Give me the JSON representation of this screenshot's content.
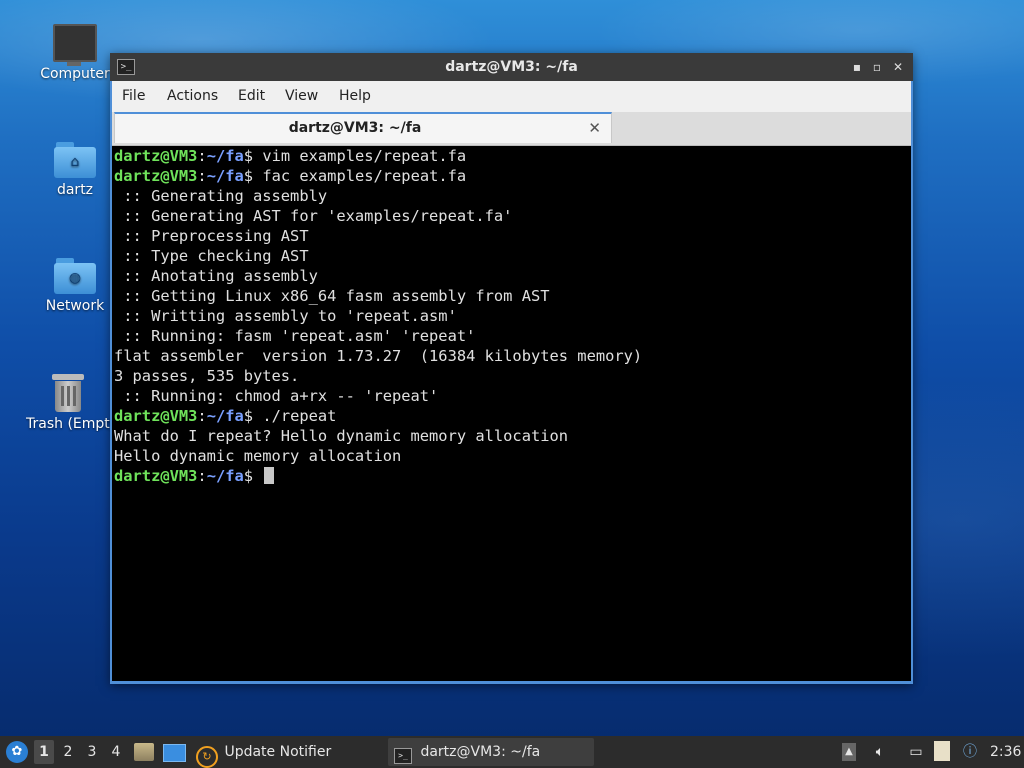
{
  "desktop": {
    "icons": [
      {
        "label": "Computer",
        "icon": "monitor-icon"
      },
      {
        "label": "dartz",
        "icon": "home-folder-icon"
      },
      {
        "label": "Network",
        "icon": "network-folder-icon"
      },
      {
        "label": "Trash (Empty)",
        "icon": "trash-icon"
      }
    ]
  },
  "window": {
    "title": "dartz@VM3: ~/fa",
    "controls": {
      "minimize": "▪",
      "restore": "▫",
      "close": "✕"
    },
    "menu": [
      "File",
      "Actions",
      "Edit",
      "View",
      "Help"
    ],
    "tab": {
      "title": "dartz@VM3: ~/fa",
      "close": "✕"
    }
  },
  "terminal": {
    "prompt": {
      "user": "dartz@VM3",
      "sep": ":",
      "path": "~/fa",
      "symbol": "$"
    },
    "lines": [
      {
        "type": "prompt",
        "cmd": " vim examples/repeat.fa"
      },
      {
        "type": "prompt",
        "cmd": " fac examples/repeat.fa"
      },
      {
        "type": "out",
        "text": " :: Generating assembly"
      },
      {
        "type": "out",
        "text": " :: Generating AST for 'examples/repeat.fa'"
      },
      {
        "type": "out",
        "text": " :: Preprocessing AST"
      },
      {
        "type": "out",
        "text": " :: Type checking AST"
      },
      {
        "type": "out",
        "text": " :: Anotating assembly"
      },
      {
        "type": "out",
        "text": " :: Getting Linux x86_64 fasm assembly from AST"
      },
      {
        "type": "out",
        "text": " :: Writting assembly to 'repeat.asm'"
      },
      {
        "type": "out",
        "text": " :: Running: fasm 'repeat.asm' 'repeat'"
      },
      {
        "type": "out",
        "text": "flat assembler  version 1.73.27  (16384 kilobytes memory)"
      },
      {
        "type": "out",
        "text": "3 passes, 535 bytes."
      },
      {
        "type": "out",
        "text": " :: Running: chmod a+rx -- 'repeat'"
      },
      {
        "type": "prompt",
        "cmd": " ./repeat"
      },
      {
        "type": "out",
        "text": "What do I repeat? Hello dynamic memory allocation"
      },
      {
        "type": "out",
        "text": "Hello dynamic memory allocation"
      },
      {
        "type": "prompt",
        "cmd": " ",
        "cursor": true
      }
    ]
  },
  "taskbar": {
    "workspaces": [
      "1",
      "2",
      "3",
      "4"
    ],
    "active_workspace": "1",
    "tasks": [
      {
        "label": "Update Notifier",
        "icon": "update-notifier-icon"
      },
      {
        "label": "dartz@VM3: ~/fa",
        "icon": "terminal-icon"
      }
    ],
    "clock": "2:36"
  }
}
